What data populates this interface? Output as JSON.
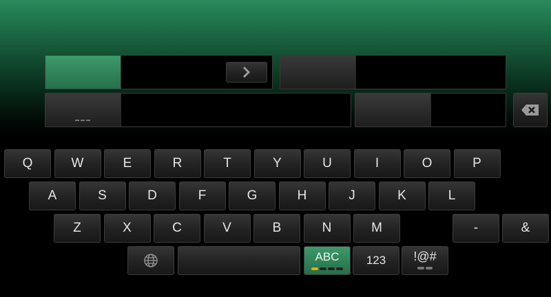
{
  "keyboard": {
    "row1": [
      "Q",
      "W",
      "E",
      "R",
      "T",
      "Y",
      "U",
      "I",
      "O",
      "P"
    ],
    "row2": [
      "A",
      "S",
      "D",
      "F",
      "G",
      "H",
      "J",
      "K",
      "L"
    ],
    "row3": [
      "Z",
      "X",
      "C",
      "V",
      "B",
      "N",
      "M"
    ],
    "symbols": [
      "-",
      "&"
    ],
    "modes": {
      "abc": "ABC",
      "num": "123",
      "sym": "!@#"
    },
    "globe_icon": "globe-icon",
    "backspace_icon": "backspace-icon",
    "next_icon": "chevron-right-icon"
  },
  "colors": {
    "accent_green": "#3c9a6a",
    "indicator": "#f0a800"
  }
}
